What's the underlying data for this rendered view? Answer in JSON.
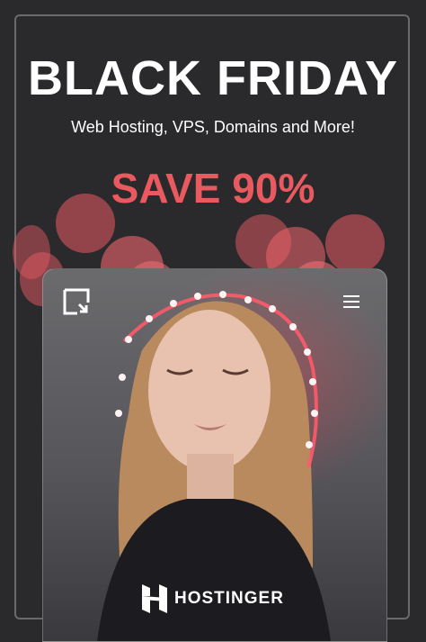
{
  "ad": {
    "headline": "BLACK FRIDAY",
    "subtitle": "Web Hosting, VPS, Domains and More!",
    "offer": "SAVE 90%"
  },
  "phone": {
    "logo_icon": "site-logo-icon",
    "menu_icon": "hamburger-menu-icon"
  },
  "brand": {
    "name": "HOSTINGER",
    "icon": "hostinger-h-logo"
  },
  "colors": {
    "background": "#2a2a2c",
    "accent": "#e85a5f",
    "text": "#ffffff"
  }
}
